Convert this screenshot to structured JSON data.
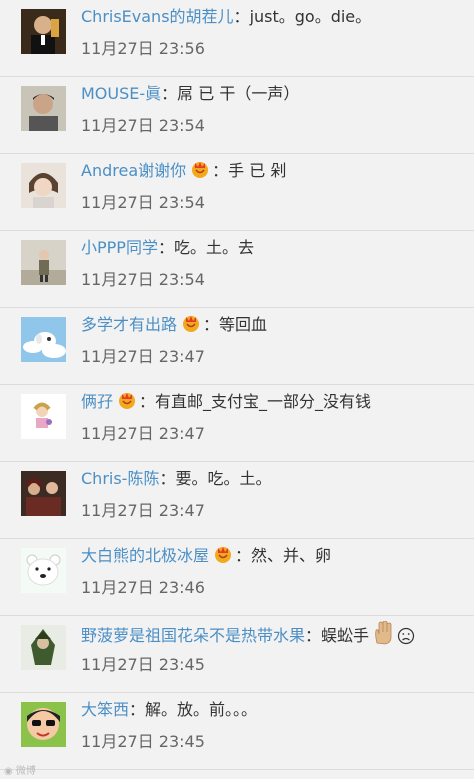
{
  "comments": [
    {
      "user": "ChrisEvans的胡茬儿",
      "sep": "：",
      "text": "just。go。die。",
      "time": "11月27日 23:56"
    },
    {
      "user": "MOUSE-眞",
      "sep": "：",
      "text": "屌 已 干（一声）",
      "time": "11月27日 23:54"
    },
    {
      "user": "Andrea谢谢你",
      "sep": "：",
      "text": "手 已 剁",
      "time": "11月27日 23:54"
    },
    {
      "user": "小PPP同学",
      "sep": "：",
      "text": "吃。土。去",
      "time": "11月27日 23:54"
    },
    {
      "user": "多学才有出路",
      "sep": "：",
      "text": "等回血",
      "time": "11月27日 23:47"
    },
    {
      "user": "俩孖",
      "sep": "：",
      "text": "有直邮_支付宝_一部分_没有钱",
      "time": "11月27日 23:47"
    },
    {
      "user": "Chris-陈陈",
      "sep": "：",
      "text": "要。吃。土。",
      "time": "11月27日 23:47"
    },
    {
      "user": "大白熊的北极冰屋",
      "sep": "：",
      "text": "然、并、卵",
      "time": "11月27日 23:46"
    },
    {
      "user": "野菠萝是祖国花朵不是热带水果",
      "sep": "：",
      "text": "蜈蚣手",
      "time": "11月27日 23:45"
    },
    {
      "user": "大笨西",
      "sep": "：",
      "text": "解。放。前。。。",
      "time": "11月27日 23:45"
    }
  ],
  "watermark": "微博"
}
